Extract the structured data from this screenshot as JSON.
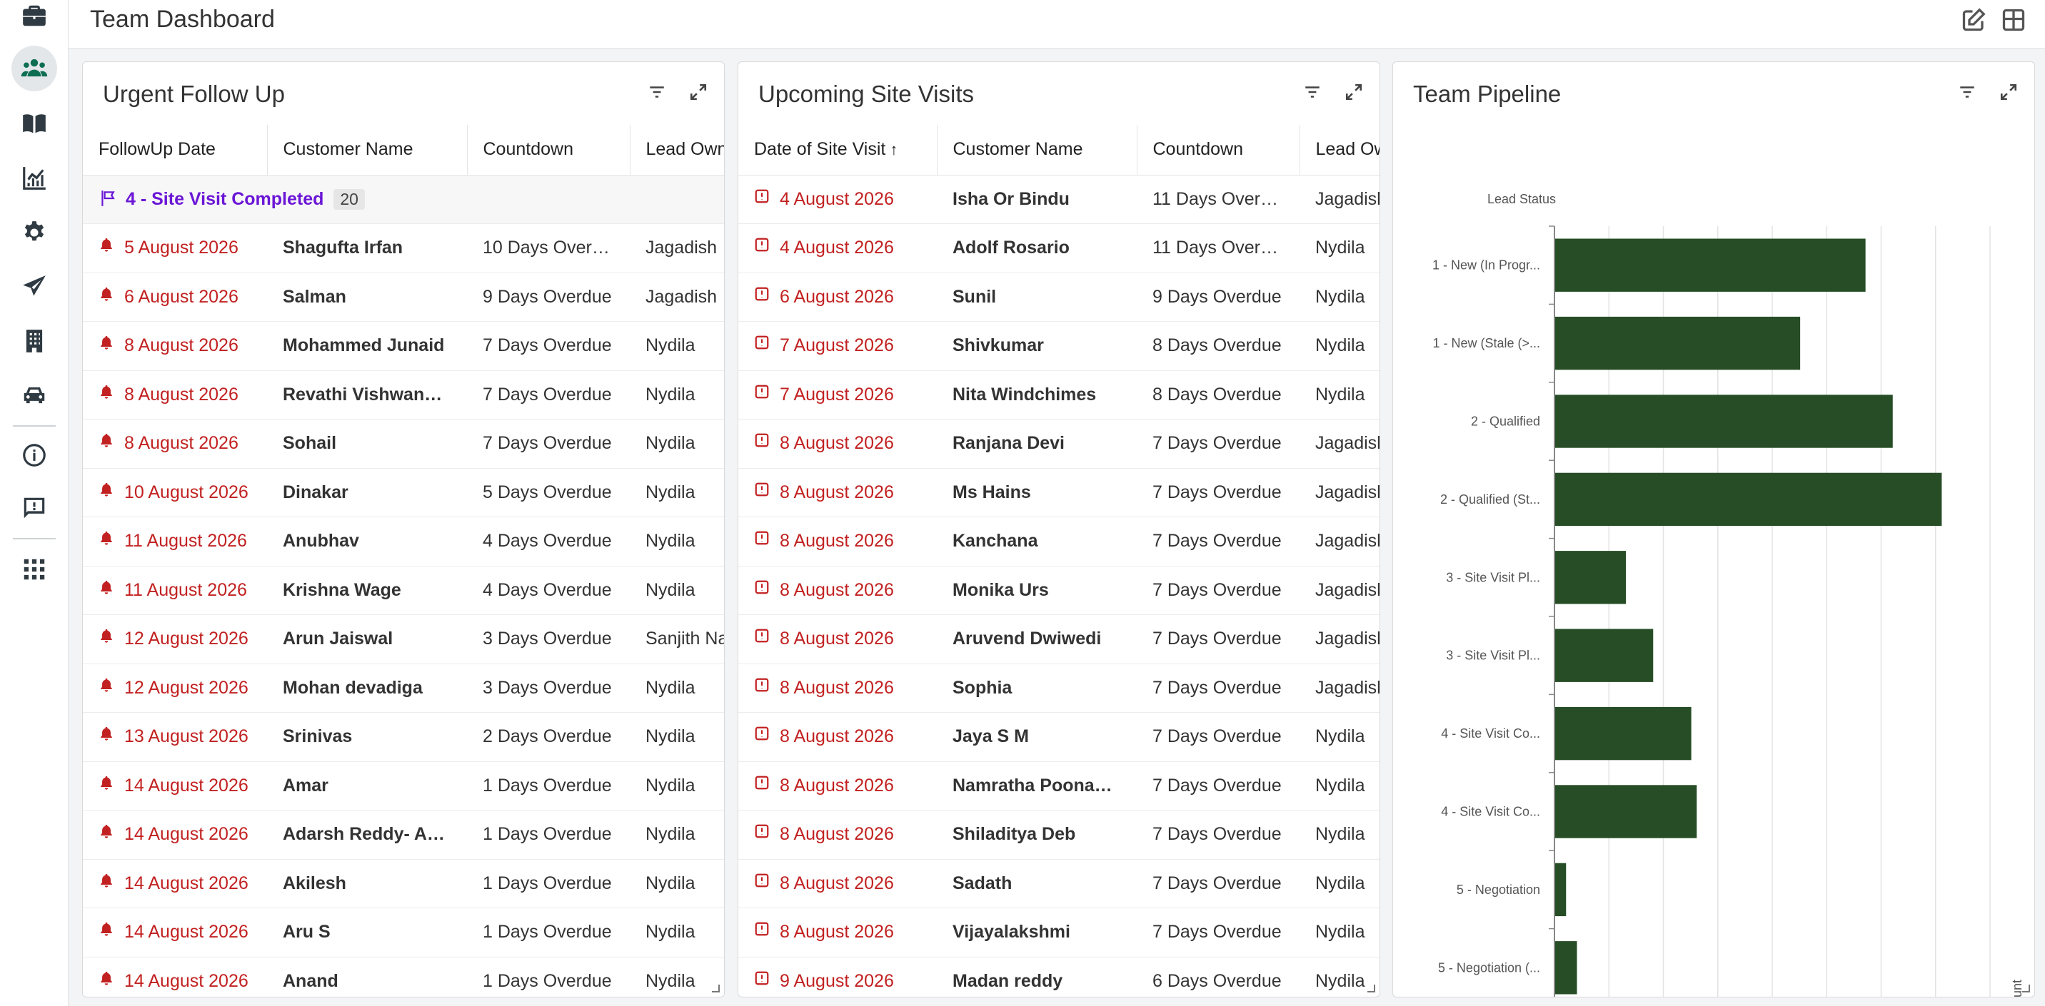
{
  "page": {
    "title": "Team Dashboard"
  },
  "sidebar": {
    "items": [
      {
        "icon": "briefcase-icon"
      },
      {
        "icon": "users-icon",
        "active": true
      },
      {
        "icon": "book-icon"
      },
      {
        "icon": "chart-line-icon"
      },
      {
        "icon": "gear-icon"
      },
      {
        "icon": "paper-plane-icon"
      },
      {
        "icon": "building-icon"
      },
      {
        "icon": "car-icon"
      },
      {
        "icon": "info-icon"
      },
      {
        "icon": "feedback-icon"
      },
      {
        "icon": "apps-grid-icon"
      }
    ]
  },
  "header": {
    "edit_icon": "edit-icon",
    "layout_icon": "layout-grid-icon"
  },
  "urgent_follow_up": {
    "title": "Urgent Follow Up",
    "columns": [
      "FollowUp Date",
      "Customer Name",
      "Countdown",
      "Lead Owner"
    ],
    "group": {
      "label": "4 - Site Visit Completed",
      "count": "20"
    },
    "rows": [
      [
        "5 August 2026",
        "Shagufta Irfan",
        "10 Days Overdue",
        "Jagadish"
      ],
      [
        "6 August 2026",
        "Salman",
        "9 Days Overdue",
        "Jagadish"
      ],
      [
        "8 August 2026",
        "Mohammed Junaid",
        "7 Days Overdue",
        "Nydila"
      ],
      [
        "8 August 2026",
        "Revathi Vishwanath…",
        "7 Days Overdue",
        "Nydila"
      ],
      [
        "8 August 2026",
        "Sohail",
        "7 Days Overdue",
        "Nydila"
      ],
      [
        "10 August 2026",
        "Dinakar",
        "5 Days Overdue",
        "Nydila"
      ],
      [
        "11 August 2026",
        "Anubhav",
        "4 Days Overdue",
        "Nydila"
      ],
      [
        "11 August 2026",
        "Krishna Wage",
        "4 Days Overdue",
        "Nydila"
      ],
      [
        "12 August 2026",
        "Arun Jaiswal",
        "3 Days Overdue",
        "Sanjith Na"
      ],
      [
        "12 August 2026",
        "Mohan devadiga",
        "3 Days Overdue",
        "Nydila"
      ],
      [
        "13 August 2026",
        "Srinivas",
        "2 Days Overdue",
        "Nydila"
      ],
      [
        "14 August 2026",
        "Amar",
        "1 Days Overdue",
        "Nydila"
      ],
      [
        "14 August 2026",
        "Adarsh Reddy- Arka…",
        "1 Days Overdue",
        "Nydila"
      ],
      [
        "14 August 2026",
        "Akilesh",
        "1 Days Overdue",
        "Nydila"
      ],
      [
        "14 August 2026",
        "Aru S",
        "1 Days Overdue",
        "Nydila"
      ],
      [
        "14 August 2026",
        "Anand",
        "1 Days Overdue",
        "Nydila"
      ]
    ]
  },
  "site_visits": {
    "title": "Upcoming Site Visits",
    "columns": [
      "Date of Site Visit",
      "Customer Name",
      "Countdown",
      "Lead Owner"
    ],
    "sort_indicator": "↑",
    "rows": [
      [
        "4 August 2026",
        "Isha Or Bindu",
        "11 Days Overdue",
        "Jagadish"
      ],
      [
        "4 August 2026",
        "Adolf Rosario",
        "11 Days Overdue",
        "Nydila"
      ],
      [
        "6 August 2026",
        "Sunil",
        "9 Days Overdue",
        "Nydila"
      ],
      [
        "7 August 2026",
        "Shivkumar",
        "8 Days Overdue",
        "Nydila"
      ],
      [
        "7 August 2026",
        "Nita Windchimes",
        "8 Days Overdue",
        "Nydila"
      ],
      [
        "8 August 2026",
        "Ranjana Devi",
        "7 Days Overdue",
        "Jagadish"
      ],
      [
        "8 August 2026",
        "Ms Hains",
        "7 Days Overdue",
        "Jagadish"
      ],
      [
        "8 August 2026",
        "Kanchana",
        "7 Days Overdue",
        "Jagadish"
      ],
      [
        "8 August 2026",
        "Monika Urs",
        "7 Days Overdue",
        "Jagadish"
      ],
      [
        "8 August 2026",
        "Aruvend Dwiwedi",
        "7 Days Overdue",
        "Jagadish"
      ],
      [
        "8 August 2026",
        "Sophia",
        "7 Days Overdue",
        "Jagadish"
      ],
      [
        "8 August 2026",
        "Jaya S M",
        "7 Days Overdue",
        "Nydila"
      ],
      [
        "8 August 2026",
        "Namratha Poonacha",
        "7 Days Overdue",
        "Nydila"
      ],
      [
        "8 August 2026",
        "Shiladitya Deb",
        "7 Days Overdue",
        "Nydila"
      ],
      [
        "8 August 2026",
        "Sadath",
        "7 Days Overdue",
        "Nydila"
      ],
      [
        "8 August 2026",
        "Vijayalakshmi",
        "7 Days Overdue",
        "Nydila"
      ],
      [
        "9 August 2026",
        "Madan reddy",
        "6 Days Overdue",
        "Nydila"
      ]
    ]
  },
  "team_pipeline": {
    "title": "Team Pipeline",
    "colors": {
      "bar": "#264d26",
      "grid": "#e3e3e3",
      "axis": "#888888"
    }
  },
  "chart_data": {
    "type": "bar",
    "orientation": "horizontal",
    "xlabel": "Count",
    "ylabel": "Lead Status",
    "xlim": [
      0,
      80
    ],
    "xticks": [
      0,
      10,
      20,
      30,
      40,
      50,
      60,
      70,
      80
    ],
    "categories": [
      "1 - New (In Progr...",
      "1 - New (Stale (>...",
      "2 - Qualified",
      "2 - Qualified (St...",
      "3 - Site Visit Pl...",
      "3 - Site Visit Pl...",
      "4 - Site Visit Co...",
      "4 - Site Visit Co...",
      "5 - Negotiation",
      "5 - Negotiation (..."
    ],
    "values": [
      57,
      45,
      62,
      71,
      13,
      18,
      25,
      26,
      2,
      4
    ],
    "grid": true
  }
}
